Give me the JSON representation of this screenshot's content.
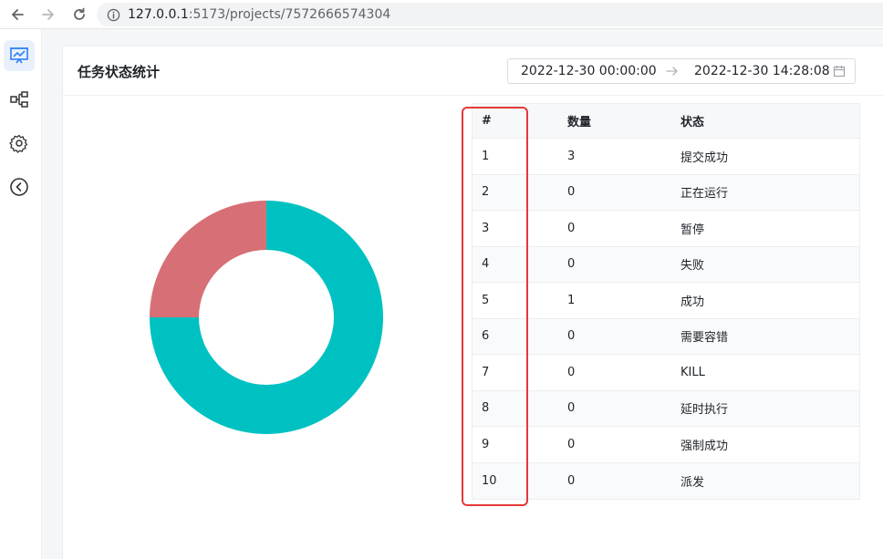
{
  "browser": {
    "url_host": "127.0.0.1",
    "url_rest": ":5173/projects/7572666574304"
  },
  "sidebar": {
    "items": [
      {
        "icon": "presentation-chart-icon",
        "active": true
      },
      {
        "icon": "workflow-icon",
        "active": false
      },
      {
        "icon": "gear-icon",
        "active": false
      },
      {
        "icon": "collapse-left-icon",
        "active": false
      }
    ]
  },
  "card": {
    "title": "任务状态统计",
    "date_start": "2022-12-30 00:00:00",
    "date_end": "2022-12-30 14:28:08"
  },
  "table": {
    "headers": [
      "#",
      "数量",
      "状态"
    ],
    "rows": [
      {
        "index": "1",
        "count": "3",
        "status": "提交成功"
      },
      {
        "index": "2",
        "count": "0",
        "status": "正在运行"
      },
      {
        "index": "3",
        "count": "0",
        "status": "暂停"
      },
      {
        "index": "4",
        "count": "0",
        "status": "失败"
      },
      {
        "index": "5",
        "count": "1",
        "status": "成功"
      },
      {
        "index": "6",
        "count": "0",
        "status": "需要容错"
      },
      {
        "index": "7",
        "count": "0",
        "status": "KILL"
      },
      {
        "index": "8",
        "count": "0",
        "status": "延时执行"
      },
      {
        "index": "9",
        "count": "0",
        "status": "强制成功"
      },
      {
        "index": "10",
        "count": "0",
        "status": "派发"
      }
    ]
  },
  "chart_data": {
    "type": "pie",
    "categories": [
      "提交成功",
      "成功"
    ],
    "values": [
      3,
      1
    ],
    "colors": [
      "#00c1c1",
      "#d67076"
    ],
    "donut": true
  }
}
